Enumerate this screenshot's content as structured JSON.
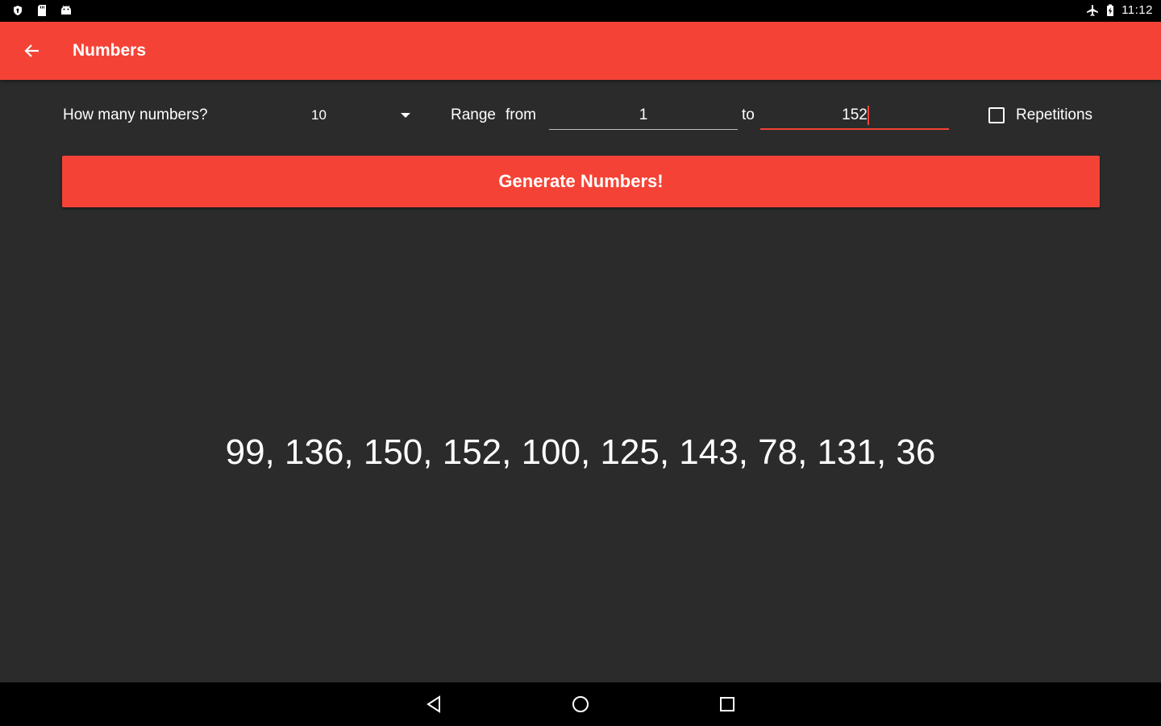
{
  "status_bar": {
    "time": "11:12",
    "left_icons": [
      "shield-icon",
      "sd-card-icon",
      "android-icon"
    ],
    "right_icons": [
      "airplane-icon",
      "battery-icon"
    ]
  },
  "app_bar": {
    "title": "Numbers",
    "back_icon": "arrow-left-icon",
    "color": "#f44336"
  },
  "controls": {
    "count_label": "How many numbers?",
    "count_value": "10",
    "range_label": "Range",
    "from_label": "from",
    "from_value": "1",
    "to_label": "to",
    "to_value": "152",
    "repetitions_label": "Repetitions",
    "repetitions_checked": false
  },
  "generate_button": {
    "label": "Generate Numbers!"
  },
  "result": {
    "text": "99, 136, 150, 152, 100, 125, 143, 78, 131, 36"
  },
  "nav_bar": {
    "icons": [
      "nav-back-icon",
      "nav-home-icon",
      "nav-recent-icon"
    ]
  }
}
